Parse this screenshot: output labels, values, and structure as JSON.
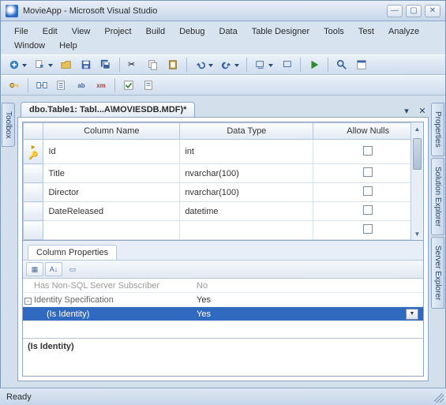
{
  "window": {
    "title": "MovieApp - Microsoft Visual Studio"
  },
  "menu": {
    "items": [
      "File",
      "Edit",
      "View",
      "Project",
      "Build",
      "Debug",
      "Data",
      "Table Designer",
      "Tools",
      "Test",
      "Analyze",
      "Window",
      "Help"
    ]
  },
  "side": {
    "left": [
      {
        "label": "Toolbox"
      }
    ],
    "right": [
      {
        "label": "Properties"
      },
      {
        "label": "Solution Explorer"
      },
      {
        "label": "Server Explorer"
      }
    ]
  },
  "doc": {
    "tab_label": "dbo.Table1: Tabl...A\\MOVIESDB.MDF)*",
    "columns": {
      "headers": {
        "name": "Column Name",
        "type": "Data Type",
        "nulls": "Allow Nulls"
      },
      "rows": [
        {
          "key": true,
          "name": "Id",
          "type": "int",
          "nulls": false
        },
        {
          "key": false,
          "name": "Title",
          "type": "nvarchar(100)",
          "nulls": false
        },
        {
          "key": false,
          "name": "Director",
          "type": "nvarchar(100)",
          "nulls": false
        },
        {
          "key": false,
          "name": "DateReleased",
          "type": "datetime",
          "nulls": false
        }
      ]
    },
    "props": {
      "tab": "Column Properties",
      "rows": [
        {
          "k": "Has Non-SQL Server Subscriber",
          "v": "No",
          "gray": true
        },
        {
          "k": "Identity Specification",
          "v": "Yes",
          "expand": "-"
        },
        {
          "k": "(Is Identity)",
          "v": "Yes",
          "sel": true,
          "child": true,
          "dd": true
        }
      ],
      "desc_title": "(Is Identity)"
    }
  },
  "status": {
    "text": "Ready"
  }
}
